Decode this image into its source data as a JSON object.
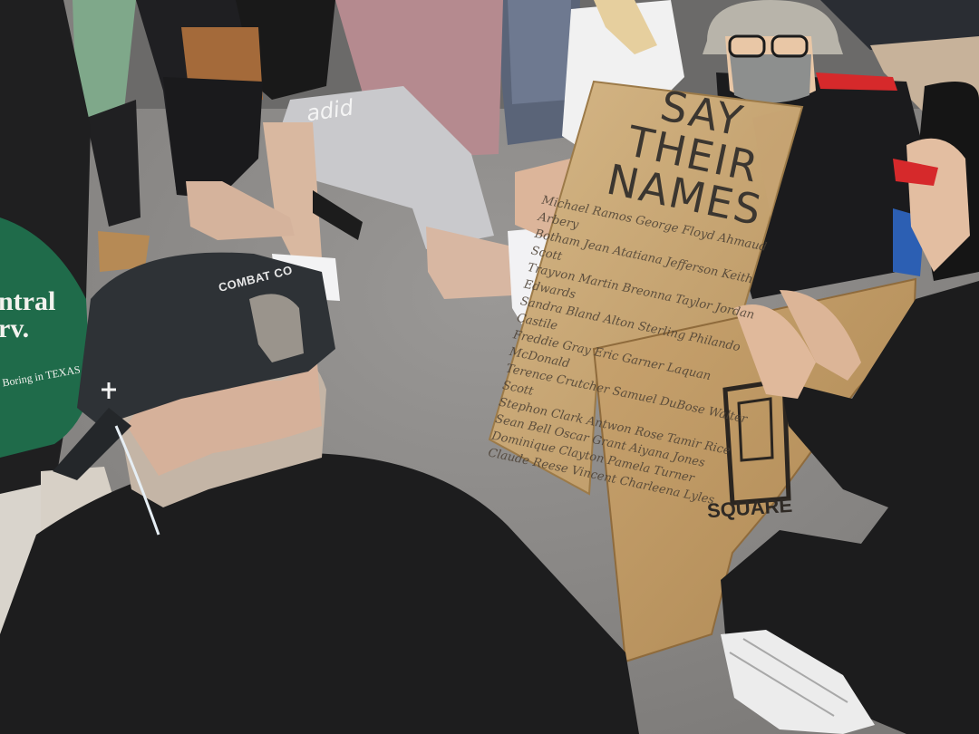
{
  "photo": {
    "sign": {
      "title_lines": [
        "SAY",
        "THEIR",
        "NAMES"
      ],
      "names_lines": [
        "Michael Ramos  George Floyd  Ahmaud Arbery",
        "Botham Jean  Atatiana Jefferson  Keith Scott",
        "Trayvon Martin  Breonna Taylor  Jordan Edwards",
        "Sandra Bland  Alton Sterling  Philando Castile",
        "Freddie Gray  Eric Garner  Laquan McDonald",
        "Terence Crutcher  Samuel DuBose  Walter Scott",
        "Stephon Clark  Antwon Rose  Tamir Rice",
        "Sean Bell  Oscar Grant  Aiyana Jones",
        "Dominique Clayton  Pamela Turner",
        "Claude Reese  Vincent  Charleena Lyles"
      ]
    },
    "cap_text": "COMBAT CO",
    "bag_text": [
      "ntral",
      "rv.",
      "Boring in TEXAS"
    ],
    "box_brand": "SQUARE",
    "shorts_text": "adid"
  },
  "colors": {
    "pavement": "#8d8b88",
    "cardboard": "#c9a978",
    "cardboard_dark": "#b8935f",
    "black_shirt": "#1d1d1e",
    "cap": "#2e3236",
    "pink_shirt": "#b58a8f",
    "grey_shorts": "#c9c9cc",
    "green_bag": "#1f6b4a",
    "red_accent": "#d6292b"
  }
}
